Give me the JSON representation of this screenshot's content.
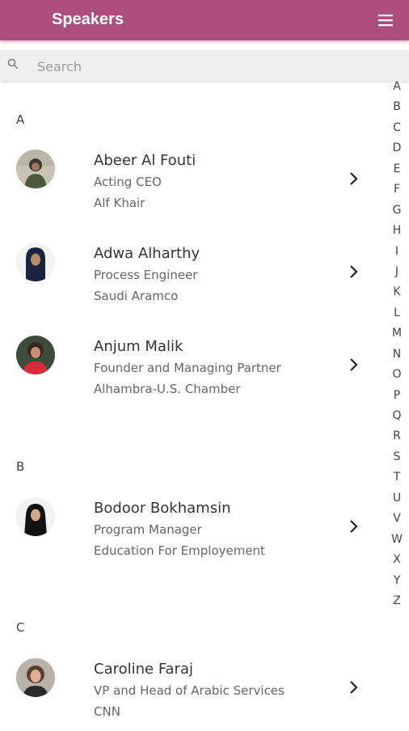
{
  "appbar": {
    "title": "Speakers",
    "menu_icon": "hamburger-menu-icon",
    "color": "#ad4f7c"
  },
  "search": {
    "placeholder": "Search",
    "value": "",
    "icon": "search-icon"
  },
  "sections": [
    {
      "letter": "A",
      "speakers": [
        {
          "name": "Abeer Al Fouti",
          "role": "Acting CEO",
          "org": "Alf Khair"
        },
        {
          "name": "Adwa Alharthy",
          "role": "Process Engineer",
          "org": "Saudi Aramco"
        },
        {
          "name": "Anjum Malik",
          "role": "Founder and Managing Partner",
          "org": "Alhambra-U.S. Chamber"
        }
      ]
    },
    {
      "letter": "B",
      "speakers": [
        {
          "name": "Bodoor Bokhamsin",
          "role": "Program Manager",
          "org": "Education For Employement"
        }
      ]
    },
    {
      "letter": "C",
      "speakers": [
        {
          "name": "Caroline Faraj",
          "role": "VP and Head of Arabic Services",
          "org": "CNN"
        }
      ]
    }
  ],
  "index_letters": [
    "A",
    "B",
    "C",
    "D",
    "E",
    "F",
    "G",
    "H",
    "I",
    "J",
    "K",
    "L",
    "M",
    "N",
    "O",
    "P",
    "Q",
    "R",
    "S",
    "T",
    "U",
    "V",
    "W",
    "X",
    "Y",
    "Z"
  ]
}
